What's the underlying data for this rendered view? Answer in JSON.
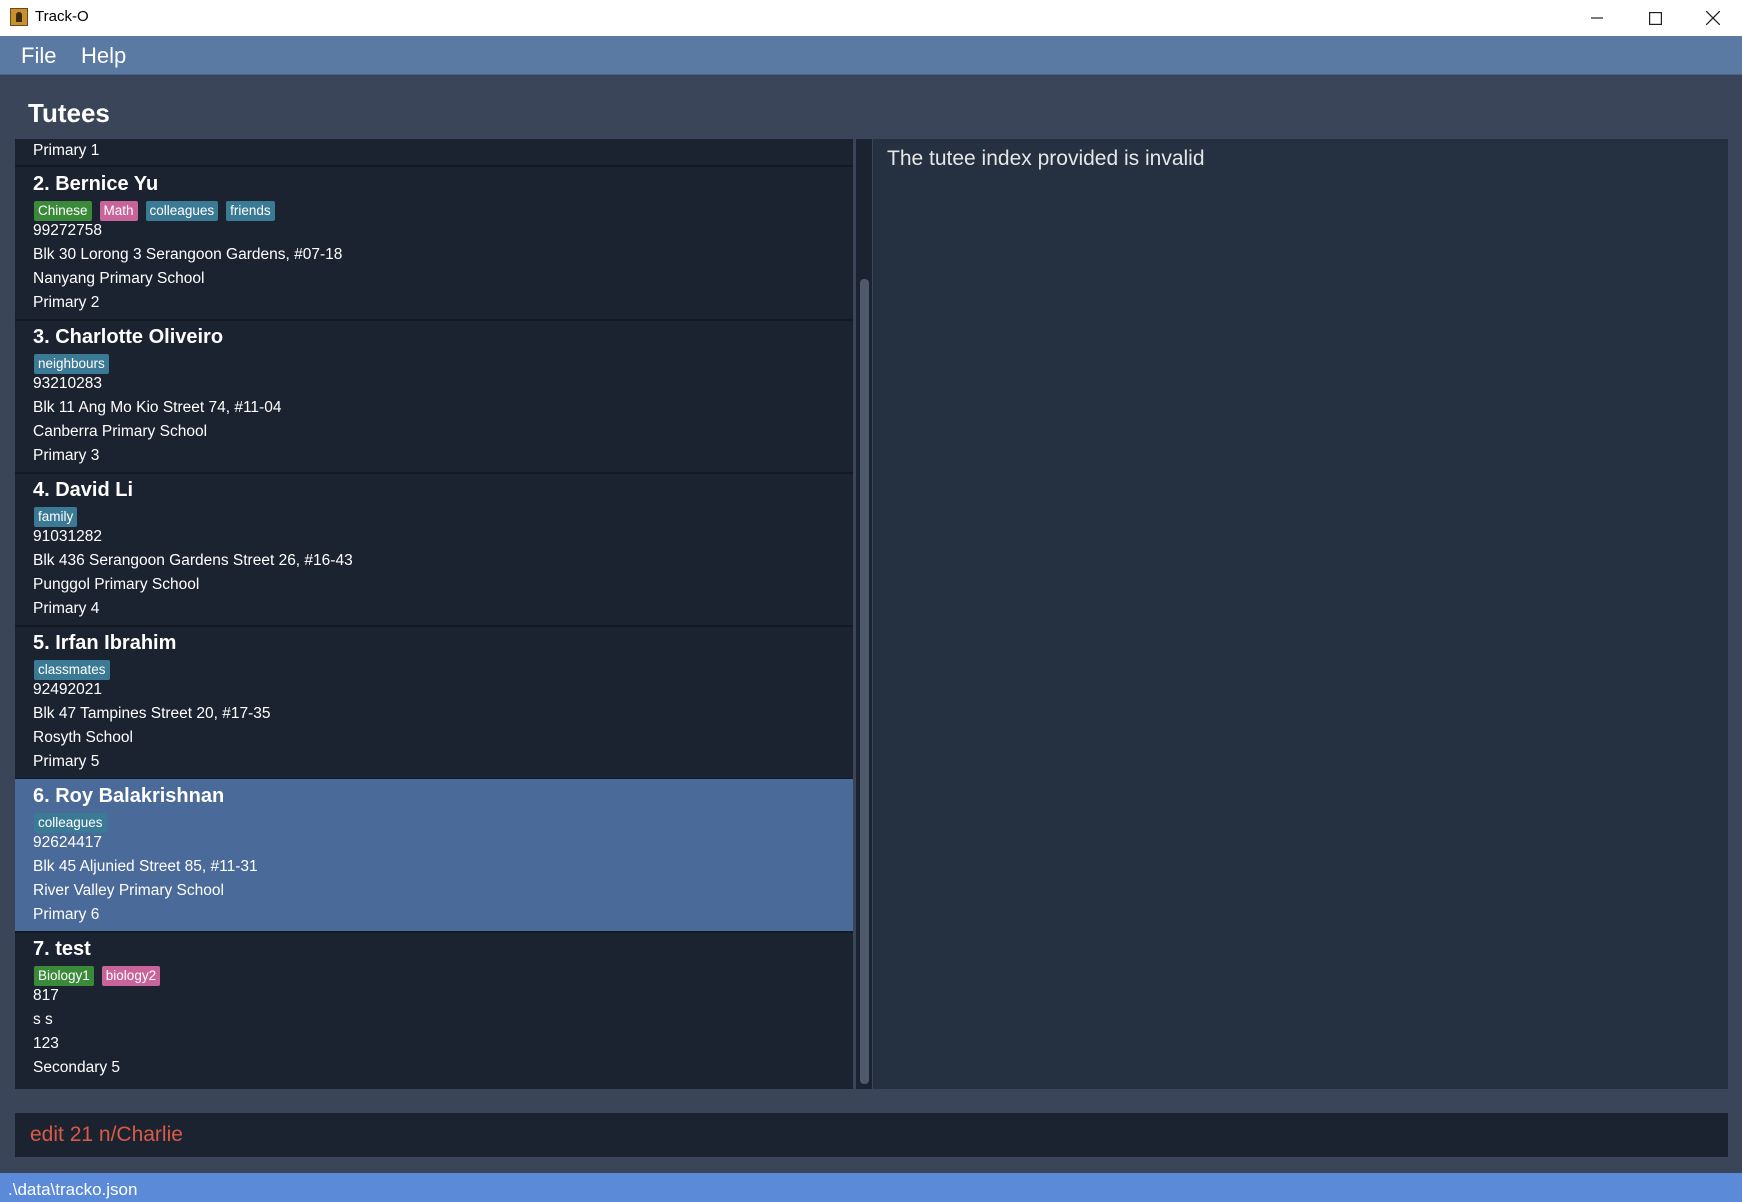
{
  "window": {
    "title": "Track-O"
  },
  "menu": {
    "file": "File",
    "help": "Help"
  },
  "section_title": "Tutees",
  "partial_top_line": "Primary 1",
  "tutees": [
    {
      "index_name": "2.  Bernice Yu",
      "tags": [
        {
          "label": "Chinese",
          "color": "#3a8a3a"
        },
        {
          "label": "Math",
          "color": "#c8649a"
        },
        {
          "label": "colleagues",
          "color": "#3b7a94"
        },
        {
          "label": "friends",
          "color": "#3b7a94"
        }
      ],
      "phone": "99272758",
      "address": "Blk 30 Lorong 3 Serangoon Gardens, #07-18",
      "school": "Nanyang Primary School",
      "level": "Primary 2",
      "selected": false
    },
    {
      "index_name": "3.  Charlotte Oliveiro",
      "tags": [
        {
          "label": "neighbours",
          "color": "#3b7a94"
        }
      ],
      "phone": "93210283",
      "address": "Blk 11 Ang Mo Kio Street 74, #11-04",
      "school": "Canberra Primary School",
      "level": "Primary 3",
      "selected": false
    },
    {
      "index_name": "4.  David Li",
      "tags": [
        {
          "label": "family",
          "color": "#3b7a94"
        }
      ],
      "phone": "91031282",
      "address": "Blk 436 Serangoon Gardens Street 26, #16-43",
      "school": "Punggol Primary School",
      "level": "Primary 4",
      "selected": false
    },
    {
      "index_name": "5.  Irfan Ibrahim",
      "tags": [
        {
          "label": "classmates",
          "color": "#3b7a94"
        }
      ],
      "phone": "92492021",
      "address": "Blk 47 Tampines Street 20, #17-35",
      "school": "Rosyth School",
      "level": "Primary 5",
      "selected": false
    },
    {
      "index_name": "6.  Roy Balakrishnan",
      "tags": [
        {
          "label": "colleagues",
          "color": "#3b7a94"
        }
      ],
      "phone": "92624417",
      "address": "Blk 45 Aljunied Street 85, #11-31",
      "school": "River Valley Primary School",
      "level": "Primary 6",
      "selected": true
    },
    {
      "index_name": "7.  test",
      "tags": [
        {
          "label": "Biology1",
          "color": "#3a8a3a"
        },
        {
          "label": "biology2",
          "color": "#c8649a"
        }
      ],
      "phone": "817",
      "address": "s s",
      "school": "123",
      "level": "Secondary 5",
      "selected": false
    }
  ],
  "result_message": "The tutee index provided is invalid",
  "command": {
    "value": "edit 21 n/Charlie"
  },
  "status": {
    "path": ".\\data\\tracko.json"
  },
  "icons": [
    "app-icon",
    "minimize-icon",
    "maximize-icon",
    "close-icon"
  ]
}
